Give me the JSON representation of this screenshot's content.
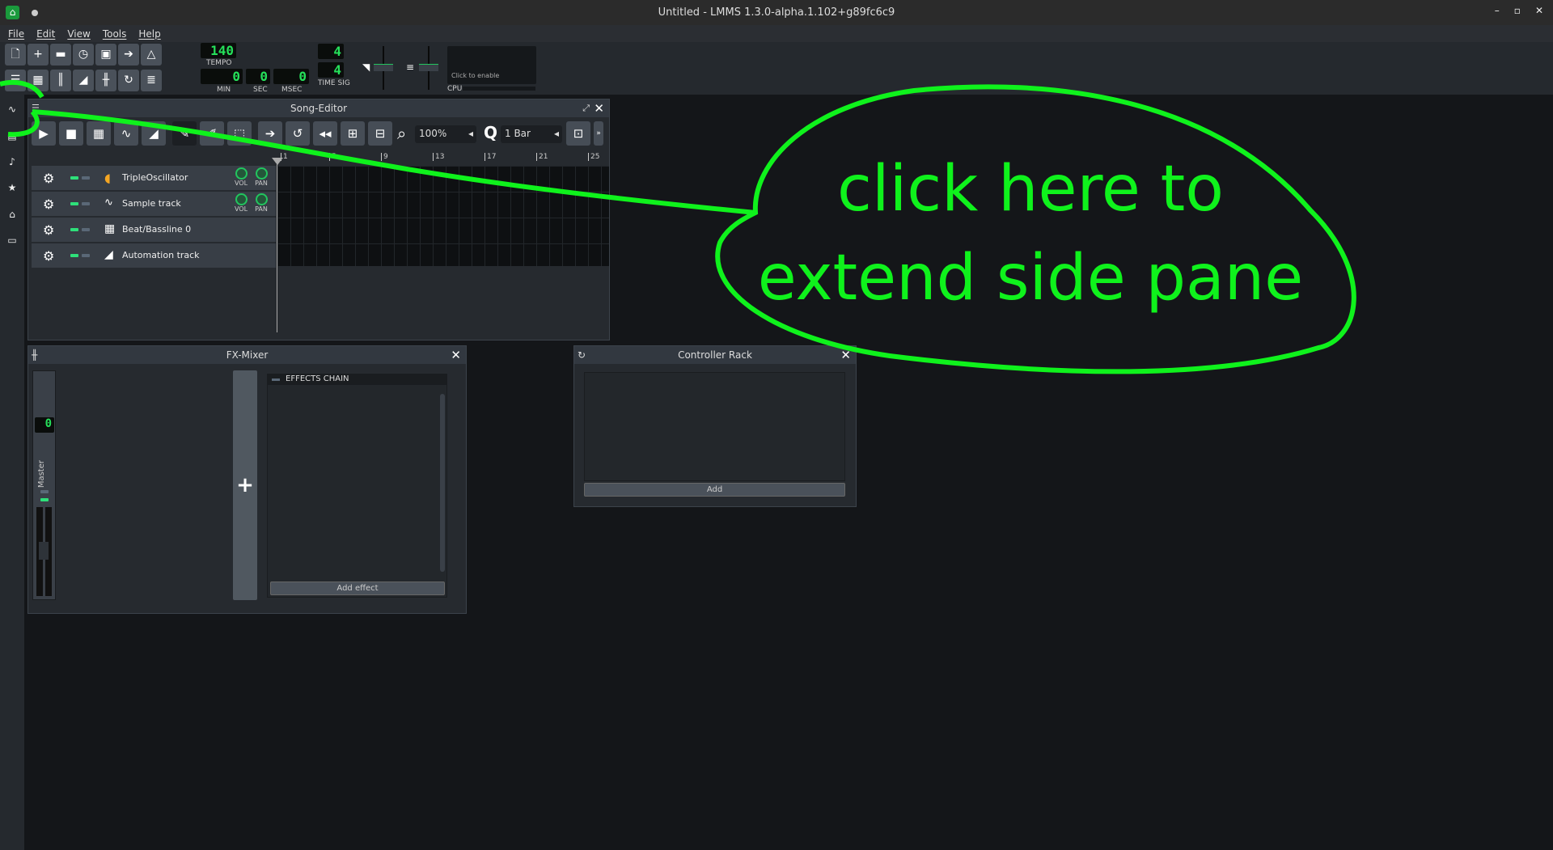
{
  "window": {
    "title": "Untitled - LMMS 1.3.0-alpha.1.102+g89fc6c9",
    "controls": [
      "–",
      "▫",
      "✕"
    ]
  },
  "menu": [
    "File",
    "Edit",
    "View",
    "Tools",
    "Help"
  ],
  "toolbar": {
    "tempo": "140",
    "tempo_label": "TEMPO",
    "min": "0",
    "sec": "0",
    "msec": "0",
    "min_label": "MIN",
    "sec_label": "SEC",
    "msec_label": "MSEC",
    "timesig_num": "4",
    "timesig_den": "4",
    "timesig_label": "TIME SIG",
    "cpu_hint": "Click to enable",
    "cpu_label": "CPU"
  },
  "song_editor": {
    "title": "Song-Editor",
    "zoom": "100%",
    "quantize": "1 Bar",
    "ruler": [
      "1",
      "5",
      "9",
      "13",
      "17",
      "21",
      "25"
    ],
    "tracks": [
      {
        "name": "TripleOscillator",
        "icon": "triple-oscillator-icon",
        "knobs": [
          "VOL",
          "PAN"
        ]
      },
      {
        "name": "Sample track",
        "icon": "waveform-icon",
        "knobs": [
          "VOL",
          "PAN"
        ]
      },
      {
        "name": "Beat/Bassline 0",
        "icon": "beat-grid-icon"
      },
      {
        "name": "Automation track",
        "icon": "automation-ramp-icon"
      }
    ]
  },
  "fx_mixer": {
    "title": "FX-Mixer",
    "channel_name": "Master",
    "channel_number": "0",
    "effects_chain": "EFFECTS CHAIN",
    "add_effect": "Add effect",
    "add_channel": "+"
  },
  "controller_rack": {
    "title": "Controller Rack",
    "add": "Add"
  },
  "annotation": {
    "line1": "click here to",
    "line2": "extend side pane",
    "color": "#0ff21c"
  },
  "colors": {
    "accent": "#22c55e",
    "background": "#141619"
  }
}
